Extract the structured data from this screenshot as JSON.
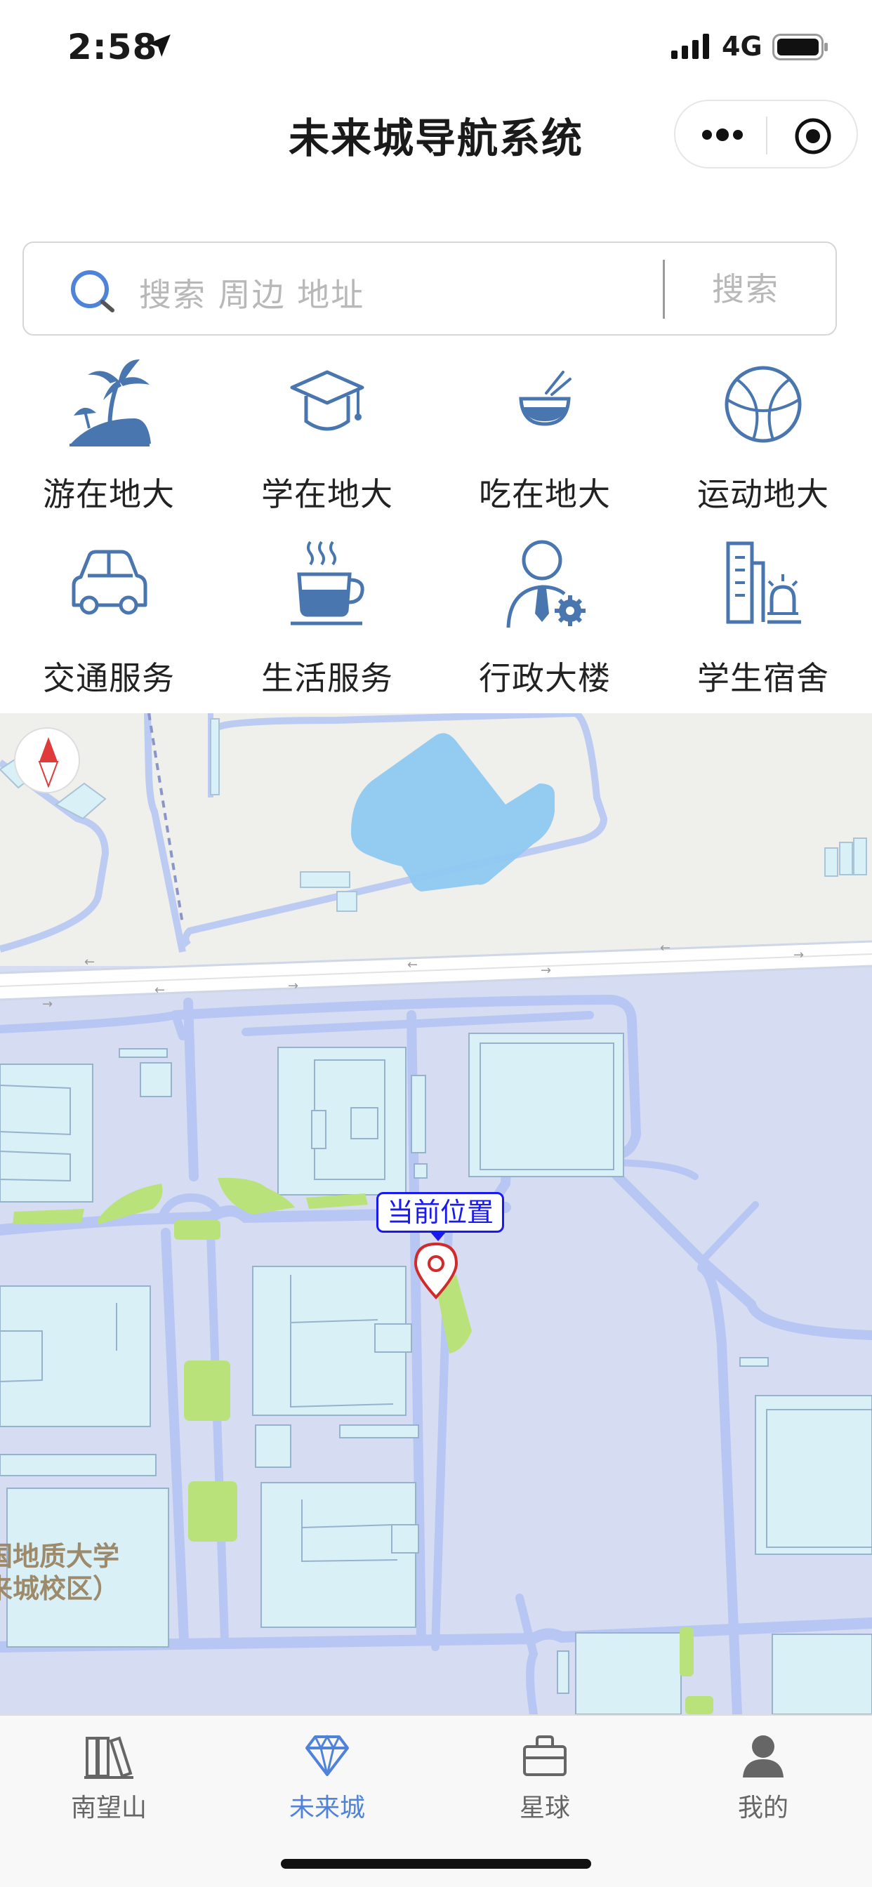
{
  "status_bar": {
    "time": "2:58",
    "network": "4G",
    "icons": [
      "location-arrow-icon",
      "signal-bars-icon",
      "battery-icon"
    ]
  },
  "nav": {
    "title": "未来城导航系统",
    "icons": [
      "more-dots-icon",
      "close-target-icon"
    ]
  },
  "search": {
    "placeholder": "搜索 周边 地址",
    "button": "搜索"
  },
  "grid": {
    "accent": "#4a76b0",
    "items": [
      {
        "label": "游在地大",
        "icon": "palm-island-icon"
      },
      {
        "label": "学在地大",
        "icon": "graduation-cap-icon"
      },
      {
        "label": "吃在地大",
        "icon": "bowl-chopsticks-icon"
      },
      {
        "label": "运动地大",
        "icon": "basketball-icon"
      },
      {
        "label": "交通服务",
        "icon": "car-icon"
      },
      {
        "label": "生活服务",
        "icon": "coffee-cup-icon"
      },
      {
        "label": "行政大楼",
        "icon": "admin-person-gear-icon"
      },
      {
        "label": "学生宿舍",
        "icon": "dormitory-building-icon"
      }
    ]
  },
  "map": {
    "callout": "当前位置",
    "campus_label_line1": "国地质大学",
    "campus_label_line2": "来城校区）",
    "colors": {
      "campus": "#d6dcf1",
      "road": "#b7c6f2",
      "building": "#d9f0f7",
      "green": "#b9e27b",
      "water": "#8ec8f1"
    }
  },
  "tabbar": {
    "active_color": "#4f83d9",
    "tabs": [
      {
        "label": "南望山",
        "icon": "books-icon",
        "active": false
      },
      {
        "label": "未来城",
        "icon": "diamond-icon",
        "active": true
      },
      {
        "label": "星球",
        "icon": "briefcase-icon",
        "active": false
      },
      {
        "label": "我的",
        "icon": "user-icon",
        "active": false
      }
    ]
  }
}
